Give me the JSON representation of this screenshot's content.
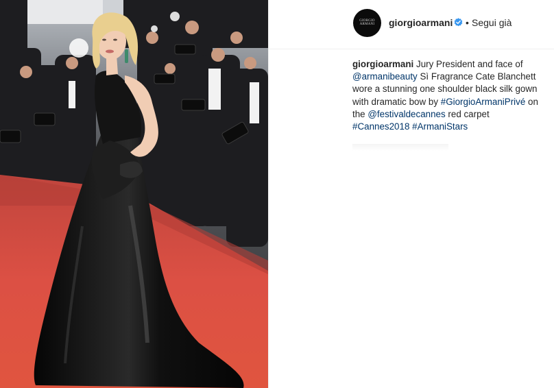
{
  "photo": {
    "alt_icon": "photo-image",
    "colors": {
      "carpet": "#d9493f",
      "gown": "#121212",
      "skin": "#f1cdb4",
      "hair": "#e9cf8f",
      "photographers": "#1f1f22",
      "backdrop": "#9aa0a6"
    }
  },
  "header": {
    "username": "giorgioarmani",
    "avatar_text": "GIORGIO ARMANI",
    "verified_icon": "verified-badge-icon",
    "separator": "•",
    "follow_label": "Segui già",
    "verified_color": "#3897f0"
  },
  "caption": {
    "username": "giorgioarmani",
    "text_1": " Jury President and face of ",
    "mention_1": "@armanibeauty",
    "text_2": " Sì Fragrance Cate Blanchett wore a stunning one shoulder black silk gown with dramatic bow by ",
    "hashtag_1": "#GiorgioArmaniPrivé",
    "text_3": " on the ",
    "mention_2": "@festivaldecannes",
    "text_4": " red carpet ",
    "hashtag_2": "#Cannes2018",
    "text_5": " ",
    "hashtag_3": "#ArmaniStars",
    "link_color": "#003569"
  }
}
